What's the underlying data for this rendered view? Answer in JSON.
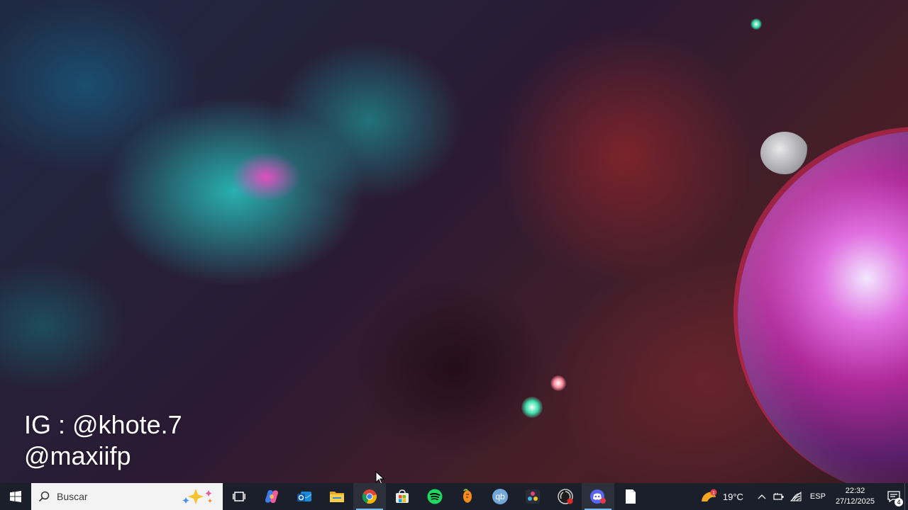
{
  "desktop": {
    "watermark_line1": "IG : @khote.7",
    "watermark_line2": "@maxiifp"
  },
  "taskbar": {
    "search_placeholder": "Buscar",
    "apps": [
      {
        "name": "task-view-icon"
      },
      {
        "name": "copilot-icon"
      },
      {
        "name": "outlook-icon"
      },
      {
        "name": "file-explorer-icon"
      },
      {
        "name": "chrome-icon",
        "active": true
      },
      {
        "name": "microsoft-store-icon"
      },
      {
        "name": "spotify-icon"
      },
      {
        "name": "fl-studio-icon"
      },
      {
        "name": "qbittorrent-icon"
      },
      {
        "name": "davinci-resolve-icon"
      },
      {
        "name": "obs-recording-icon"
      },
      {
        "name": "discord-icon"
      },
      {
        "name": "notepad-icon"
      }
    ],
    "tray": {
      "weather_temp": "19°C",
      "weather_badge": "1",
      "language": "ESP",
      "time": "22:32",
      "date": "27/12/2025",
      "notification_count": "4"
    }
  },
  "colors": {
    "taskbar_bg": "#1b1f2a",
    "accent": "#76b9ed"
  }
}
